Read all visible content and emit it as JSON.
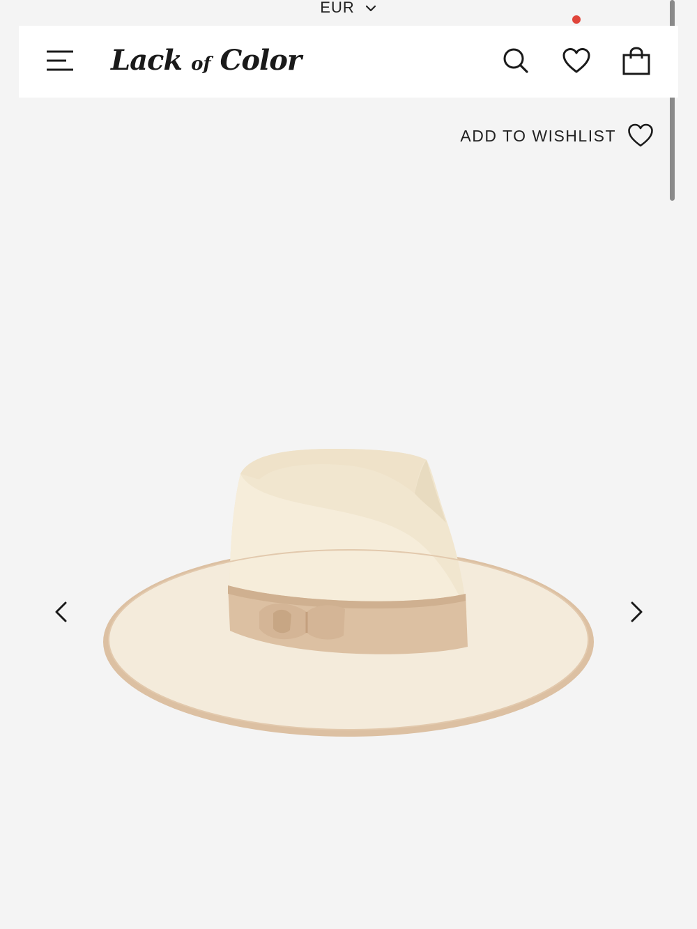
{
  "currency": {
    "selected": "EUR"
  },
  "header": {
    "logo_main": "Lack",
    "logo_of": "of",
    "logo_end": "Color",
    "icons": [
      "menu-icon",
      "search-icon",
      "heart-icon",
      "shopping-bag-icon"
    ],
    "notification_color": "#e0453a"
  },
  "product": {
    "wishlist_label": "ADD TO WISHLIST",
    "image": "cream felt rancher hat with tan grosgrain band",
    "colors": {
      "hat": "#f3ead9",
      "band": "#dcc0a2",
      "trim": "#d9bea0"
    }
  },
  "gallery": {
    "prev_icon": "chevron-left-icon",
    "next_icon": "chevron-right-icon"
  }
}
